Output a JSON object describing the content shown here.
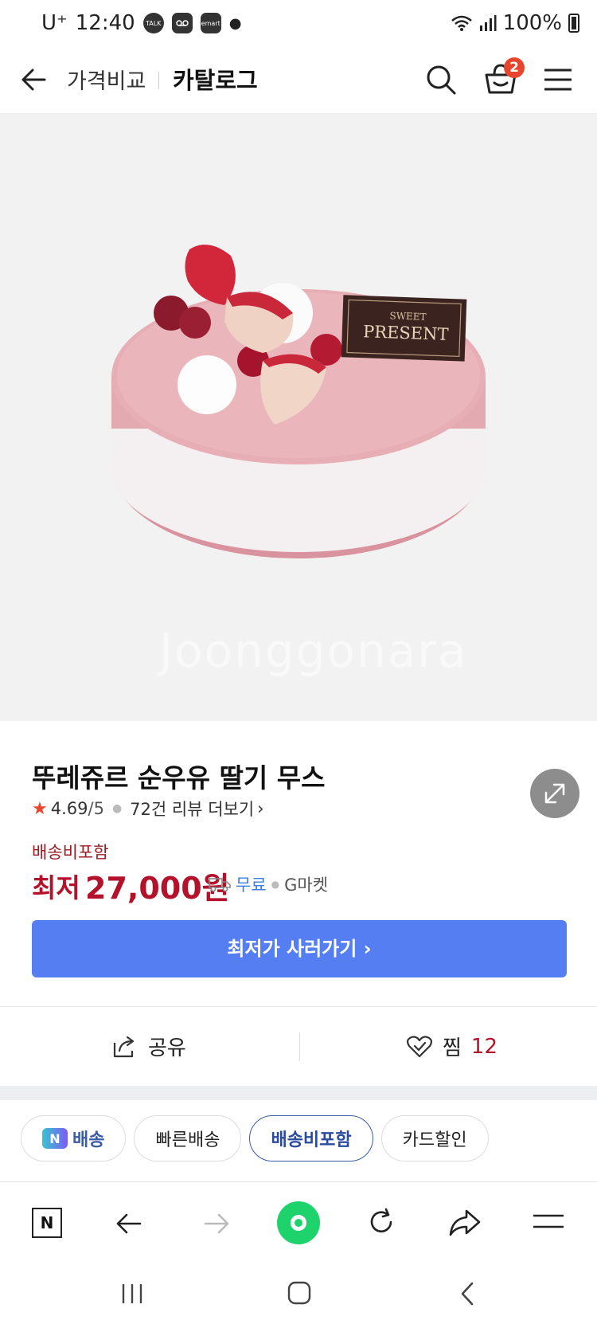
{
  "status_bar": {
    "carrier": "U⁺",
    "time": "12:40",
    "app_icons": [
      "TALK",
      "emart"
    ],
    "battery": "100%"
  },
  "header": {
    "crumb_1": "가격비교",
    "crumb_2": "카탈로그",
    "cart_count": "2"
  },
  "hero": {
    "cake_plaque_line1": "SWEET",
    "cake_plaque_line2": "PRESENT",
    "watermark": "Joonggonara"
  },
  "product": {
    "title": "뚜레쥬르 순우유 딸기 무스",
    "rating": "4.69",
    "rating_max": "/5",
    "review_text": "72건 리뷰 더보기",
    "shipping_included": "배송비포함",
    "price_label": "최저",
    "price": "27,000원",
    "shipping_free": "무료",
    "seller": "G마켓",
    "cta_label": "최저가 사러가기 ›"
  },
  "actions": {
    "share_label": "공유",
    "zzim_label": "찜",
    "zzim_count": "12"
  },
  "filters": [
    {
      "label": "배송",
      "badge": "N",
      "active": false
    },
    {
      "label": "빠른배송",
      "active": false
    },
    {
      "label": "배송비포함",
      "active": true
    },
    {
      "label": "카드할인",
      "active": false
    }
  ],
  "browser_bar": {
    "home_icon": "N"
  },
  "colors": {
    "accent_blue": "#557ef2",
    "price_red": "#b3122a",
    "badge_red": "#e8452c",
    "green_btn": "#1ed26c"
  }
}
